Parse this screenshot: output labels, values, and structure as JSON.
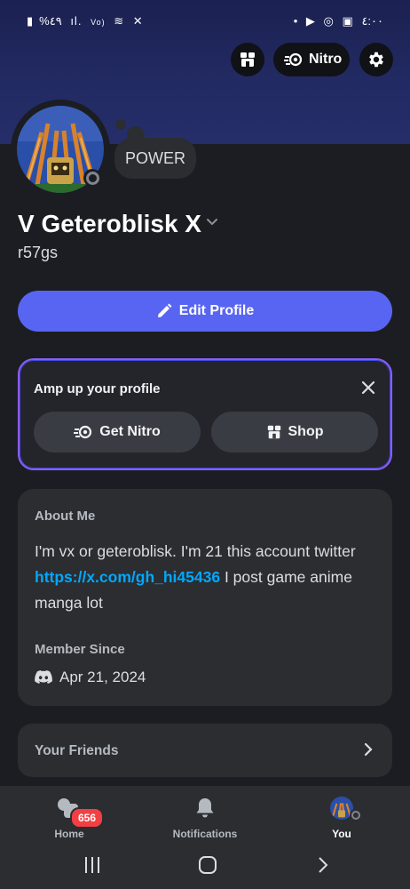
{
  "status_bar": {
    "left_text": "%٤٩",
    "time": "٤:٠٠"
  },
  "header": {
    "nitro_label": "Nitro"
  },
  "profile": {
    "status_bubble": "POWER",
    "display_name": "V Geteroblisk X",
    "username": "r57gs",
    "edit_label": "Edit Profile"
  },
  "amp": {
    "title": "Amp up your profile",
    "get_nitro_label": "Get Nitro",
    "shop_label": "Shop"
  },
  "about": {
    "heading": "About Me",
    "text_before_link": "I'm vx or geteroblisk. I'm 21 this account twitter ",
    "link": "https://x.com/gh_hi45436",
    "text_after_link": " I post game anime manga lot",
    "member_since_heading": "Member Since",
    "member_since_date": "Apr 21, 2024"
  },
  "friends": {
    "label": "Your Friends"
  },
  "bottom_nav": {
    "items": [
      {
        "label": "Home",
        "badge": "656"
      },
      {
        "label": "Notifications"
      },
      {
        "label": "You"
      }
    ]
  },
  "colors": {
    "accent": "#5865f2",
    "banner": "#222a63",
    "link": "#00a8fc",
    "badge": "#f23f43",
    "card_border": "#8b5cf6"
  },
  "icons": {
    "shop": "shop-icon",
    "nitro": "nitro-icon",
    "settings": "gear-icon",
    "edit": "pencil-icon",
    "close": "close-icon",
    "discord": "discord-icon",
    "bell": "bell-icon",
    "chevron": "chevron-right-icon"
  }
}
